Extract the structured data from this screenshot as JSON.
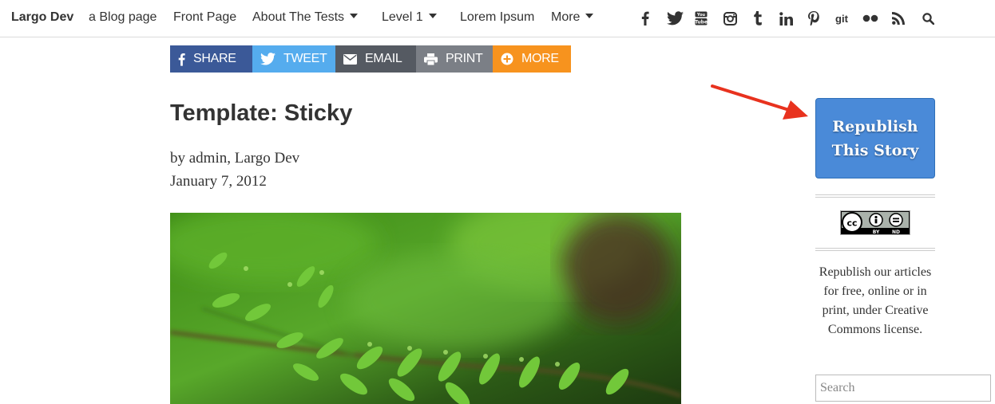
{
  "nav": {
    "brand": "Largo Dev",
    "items": [
      {
        "label": "a Blog page"
      },
      {
        "label": "Front Page"
      },
      {
        "label": "About The Tests"
      },
      {
        "label": "Level 1"
      },
      {
        "label": "Lorem Ipsum"
      },
      {
        "label": "More"
      }
    ],
    "social": [
      {
        "icon": "facebook-icon"
      },
      {
        "icon": "twitter-icon"
      },
      {
        "icon": "youtube-icon"
      },
      {
        "icon": "instagram-icon"
      },
      {
        "icon": "tumblr-icon"
      },
      {
        "icon": "linkedin-icon"
      },
      {
        "icon": "pinterest-icon"
      },
      {
        "icon": "github-icon",
        "text": "git"
      },
      {
        "icon": "flickr-icon"
      },
      {
        "icon": "rss-icon"
      },
      {
        "icon": "search-icon"
      }
    ]
  },
  "share": {
    "buttons": [
      {
        "label": "SHARE",
        "icon": "facebook-icon",
        "color": "#3b5998"
      },
      {
        "label": "TWEET",
        "icon": "twitter-icon",
        "color": "#55acee"
      },
      {
        "label": "EMAIL",
        "icon": "envelope-icon",
        "color": "#555a62"
      },
      {
        "label": "PRINT",
        "icon": "printer-icon",
        "color": "#7b7f86"
      },
      {
        "label": "MORE",
        "icon": "plus-circle-icon",
        "color": "#f7931e"
      }
    ]
  },
  "article": {
    "title": "Template: Sticky",
    "byline": "by admin, Largo Dev",
    "date": "January 7, 2012",
    "image_alt": "fern-photo"
  },
  "sidebar": {
    "republish_line1": "Republish",
    "republish_line2": "This Story",
    "republish_color": "#4a8ad8",
    "cc_badge": {
      "left": "BY",
      "right": "ND"
    },
    "cc_text": "Republish our articles for free, online or in print, under Creative Commons license.",
    "search_placeholder": "Search"
  },
  "annotation": {
    "arrow_color": "#e8321e"
  }
}
